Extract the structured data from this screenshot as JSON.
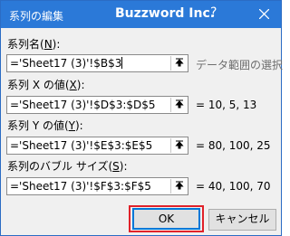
{
  "window": {
    "title": "系列の編集",
    "watermark": "Buzzword Inc.",
    "help_label": "?",
    "close_icon": "close-icon"
  },
  "fields": [
    {
      "label_prefix": "系列名(",
      "label_key": "N",
      "label_suffix": "):",
      "value": "='Sheet17 (3)'!$B$3",
      "side_text": "データ範囲の選択",
      "side_is_hint": true
    },
    {
      "label_prefix": "系列 X の値(",
      "label_key": "X",
      "label_suffix": "):",
      "value": "='Sheet17 (3)'!$D$3:$D$5",
      "side_text": "= 10, 5, 13",
      "side_is_hint": false
    },
    {
      "label_prefix": "系列 Y の値(",
      "label_key": "Y",
      "label_suffix": "):",
      "value": "='Sheet17 (3)'!$E$3:$E$5",
      "side_text": "= 80, 100, 25",
      "side_is_hint": false
    },
    {
      "label_prefix": "系列のバブル サイズ(",
      "label_key": "S",
      "label_suffix": "):",
      "value": "='Sheet17 (3)'!$F$3:$F$5",
      "side_text": "= 40, 100, 70",
      "side_is_hint": false
    }
  ],
  "buttons": {
    "ok_label": "OK",
    "cancel_label": "キャンセル"
  },
  "colors": {
    "titlebar": "#2b79d8",
    "ok_highlight": "#e0222a",
    "default_button_border": "#0078d7"
  }
}
